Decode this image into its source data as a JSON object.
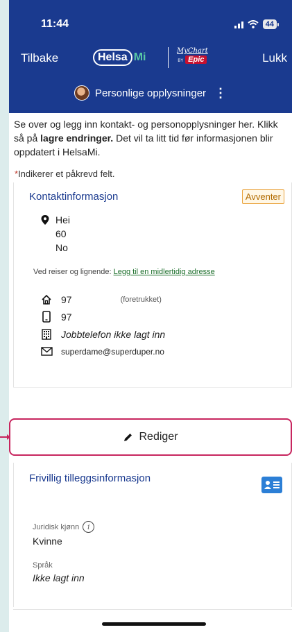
{
  "status_bar": {
    "time": "11:44",
    "battery": "44"
  },
  "nav": {
    "back_label": "Tilbake",
    "close_label": "Lukk",
    "logo_helsa": "Helsa",
    "logo_mi": "Mi",
    "logo_mychart": "MyChart",
    "logo_by": "BY",
    "logo_epic": "Epic"
  },
  "page": {
    "title": "Personlige opplysninger"
  },
  "intro": {
    "text_before": "Se over og legg inn kontakt- og personopplysninger her. Klikk så på ",
    "bold": "lagre endringer.",
    "text_after": " Det vil ta litt tid før informasjonen blir oppdatert i HelsaMi."
  },
  "required_note": {
    "star": "*",
    "text": "Indikerer et påkrevd felt."
  },
  "contact_card": {
    "title": "Kontaktinformasjon",
    "status_badge": "Avventer",
    "address_lines": [
      "Hei",
      "60",
      "No"
    ],
    "temp_prefix": "Ved reiser og lignende: ",
    "temp_link": "Legg til en midlertidig adresse",
    "home_phone": "97",
    "home_pref": "(foretrukket)",
    "mobile_phone": "97",
    "work_phone": "Jobbtelefon ikke lagt inn",
    "email": "superdame@superduper.no"
  },
  "edit_button": {
    "label": "Rediger"
  },
  "extra_card": {
    "title": "Frivillig tilleggsinformasjon",
    "legal_gender_label": "Juridisk kjønn",
    "legal_gender_value": "Kvinne",
    "language_label": "Språk",
    "language_value": "Ikke lagt inn"
  },
  "colors": {
    "header_bg": "#1a3a8f",
    "highlight": "#c7255e",
    "badge_border": "#e9a23b",
    "link_green": "#1b6e2a"
  }
}
